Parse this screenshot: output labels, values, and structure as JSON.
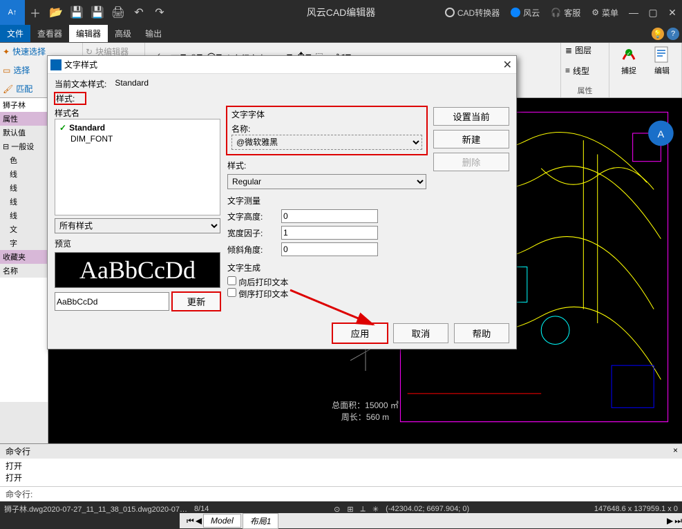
{
  "titlebar": {
    "app_title": "风云CAD编辑器",
    "converter": "CAD转换器",
    "fengyun": "风云",
    "support": "客服",
    "menu": "菜单"
  },
  "menubar": {
    "file": "文件",
    "viewer": "查看器",
    "editor": "编辑器",
    "advanced": "高级",
    "output": "输出"
  },
  "ribbon": {
    "quick_select": "快速选择",
    "block_editor": "块编辑器",
    "select": "选择",
    "match": "匹配",
    "multiline_text": "多行文本",
    "layer": "图层",
    "linetype": "线型",
    "properties": "属性",
    "snap": "捕捉",
    "edit": "编辑"
  },
  "leftpane": {
    "tab": "狮子林",
    "properties": "属性",
    "default": "默认值",
    "general": "一般设",
    "rows": [
      "色",
      "线",
      "线",
      "线",
      "线",
      "文",
      "字"
    ],
    "favorites": "收藏夹",
    "name": "名称"
  },
  "canvas": {
    "area_label": "总面积：",
    "area_value": "15000 ㎡",
    "perimeter_label": "周长：",
    "perimeter_value": "560 m"
  },
  "viewtabs": {
    "model": "Model",
    "layout1": "布局1"
  },
  "cmdline": {
    "header": "命令行",
    "log": [
      "打开",
      "打开"
    ],
    "prompt": "命令行:"
  },
  "statusbar": {
    "file": "狮子林.dwg2020-07-27_11_11_38_015.dwg2020-07…",
    "page": "8/14",
    "coords": "(-42304.02; 6697.904; 0)",
    "dims": "147648.6 x 137959.1 x 0"
  },
  "dialog": {
    "title": "文字样式",
    "current_style_label": "当前文本样式:",
    "current_style_value": "Standard",
    "style_label": "样式:",
    "style_name": "样式名",
    "items": [
      {
        "name": "Standard",
        "checked": true
      },
      {
        "name": "DIM_FONT",
        "checked": false
      }
    ],
    "all_styles": "所有样式",
    "preview_label": "预览",
    "preview_text": "AaBbCcDd",
    "sample_value": "AaBbCcDd",
    "update": "更新",
    "font_section": "文字字体",
    "font_name_label": "名称:",
    "font_name_value": "@微软雅黑",
    "font_style_label": "样式:",
    "font_style_value": "Regular",
    "measure_section": "文字测量",
    "height_label": "文字高度:",
    "height_value": "0",
    "width_label": "宽度因子:",
    "width_value": "1",
    "angle_label": "倾斜角度:",
    "angle_value": "0",
    "gen_section": "文字生成",
    "backward": "向后打印文本",
    "upside": "倒序打印文本",
    "set_current": "设置当前",
    "new": "新建",
    "delete": "删除",
    "apply": "应用",
    "cancel": "取消",
    "help": "帮助"
  }
}
